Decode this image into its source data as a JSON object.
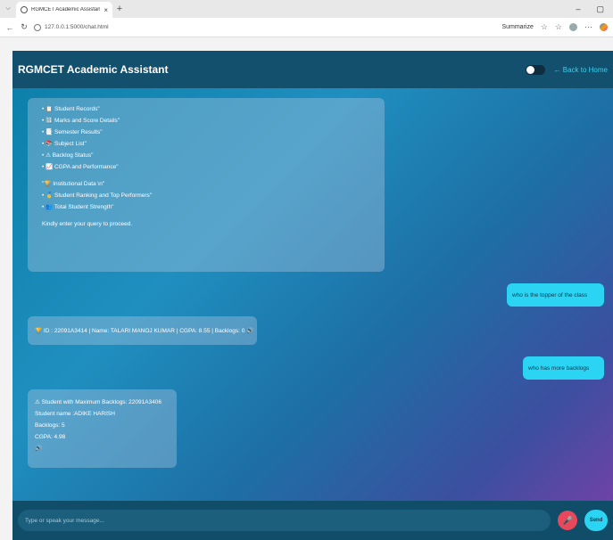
{
  "browser": {
    "tab_title": "RGMCET Academic Assistant",
    "tab_close": "×",
    "new_tab": "+",
    "url": "127.0.0.1:5000/chat.html",
    "summarize_label": "Summarize",
    "minimize": "–",
    "maximize": "▢"
  },
  "header": {
    "title": "RGMCET Academic Assistant",
    "back_link": "← Back to Home"
  },
  "messages": {
    "bot_menu": {
      "lines1": [
        "• 📋 Student Records\"",
        "• 🔢 Marks and Score Details\"",
        "• 📑 Semester Results\"",
        "• 📚 Subject List\"",
        "• ⚠ Backlog Status\"",
        "• 📈 CGPA and Performance\""
      ],
      "lines2": [
        "\"🏆 Institutional Data \\n\"",
        "• 🥇 Student Ranking and Top Performers\"",
        "• 👥 Total Student Strength\""
      ],
      "prompt": "Kindly enter your query to proceed."
    },
    "user1": "who is the topper  of the class",
    "bot2": "🏆 ID : 22091A3414 | Name: TALARI MANOJ KUMAR | CGPA: 8.55 | Backlogs: 0 🔊",
    "user2": "who has more backlogs",
    "bot3": [
      "⚠ Student with Maximum Backlogs: 22091A3406",
      "Student name :ADIKE HARISH",
      "Backlogs: 5",
      " CGPA: 4.98",
      "🔊"
    ]
  },
  "input": {
    "placeholder": "Type or speak your message...",
    "send_label": "Send"
  },
  "colors": {
    "header_bg": "#13506e",
    "user_bubble": "#2ad4f2",
    "mic_button": "#e8485b",
    "send_button": "#2ad4f2"
  }
}
